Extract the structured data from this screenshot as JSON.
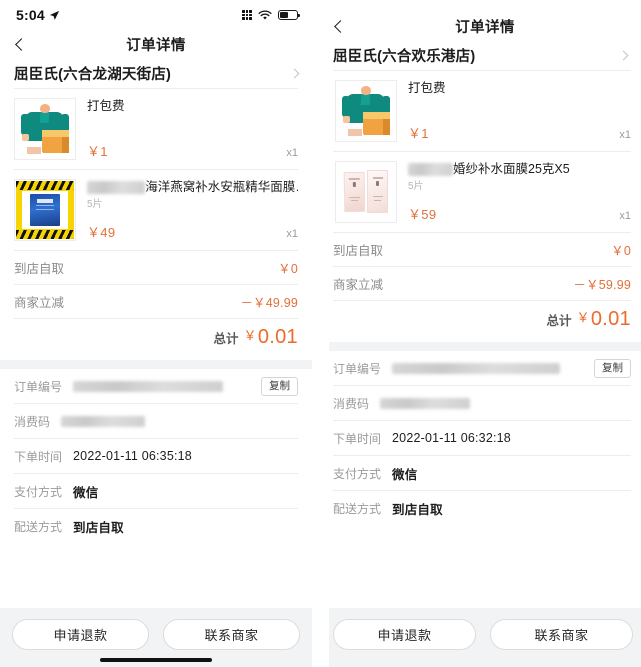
{
  "left": {
    "status_bar": {
      "time": "5:04",
      "location_icon": "location-arrow-icon",
      "signal_icon": "signal-dots-icon",
      "wifi_icon": "wifi-icon",
      "battery_icon": "battery-icon"
    },
    "nav": {
      "title": "订单详情",
      "back_icon": "chevron-left-icon"
    },
    "store": {
      "name": "屈臣氏(六合龙湖天街店)",
      "chevron_icon": "chevron-right-icon"
    },
    "items": [
      {
        "name": "打包费",
        "spec": "",
        "price": "￥1",
        "qty": "x1",
        "thumb": "packaging-fee-illustration",
        "redacted_prefix": false
      },
      {
        "name": "海洋燕窝补水安瓶精华面膜…",
        "spec": "5片",
        "price": "￥49",
        "qty": "x1",
        "thumb": "face-mask-box-caution-tape",
        "redacted_prefix": true
      }
    ],
    "fees": [
      {
        "label": "到店自取",
        "value": "￥0"
      },
      {
        "label": "商家立减",
        "value": "－￥49.99"
      }
    ],
    "total": {
      "label": "总计",
      "currency": "￥",
      "amount": "0.01"
    },
    "info": [
      {
        "label": "订单编号",
        "value": "",
        "redacted": true,
        "action": "复制"
      },
      {
        "label": "消费码",
        "value": "",
        "redacted": true,
        "action": ""
      },
      {
        "label": "下单时间",
        "value": "2022-01-11 06:35:18",
        "redacted": false,
        "action": ""
      },
      {
        "label": "支付方式",
        "value": "微信",
        "redacted": false,
        "action": ""
      },
      {
        "label": "配送方式",
        "value": "到店自取",
        "redacted": false,
        "action": ""
      }
    ],
    "actions": [
      "申请退款",
      "联系商家"
    ],
    "home_indicator": true
  },
  "right": {
    "nav": {
      "title": "订单详情",
      "back_icon": "chevron-left-icon"
    },
    "store": {
      "name": "屈臣氏(六合欢乐港店)",
      "chevron_icon": "chevron-right-icon"
    },
    "items": [
      {
        "name": "打包费",
        "spec": "",
        "price": "￥1",
        "qty": "x1",
        "thumb": "packaging-fee-illustration",
        "redacted_prefix": false
      },
      {
        "name": "婚纱补水面膜25克X5",
        "spec": "5片",
        "price": "￥59",
        "qty": "x1",
        "thumb": "wedding-mask-sachets",
        "redacted_prefix": true
      }
    ],
    "fees": [
      {
        "label": "到店自取",
        "value": "￥0"
      },
      {
        "label": "商家立减",
        "value": "－￥59.99"
      }
    ],
    "total": {
      "label": "总计",
      "currency": "￥",
      "amount": "0.01"
    },
    "info": [
      {
        "label": "订单编号",
        "value": "",
        "redacted": true,
        "action": "复制"
      },
      {
        "label": "消费码",
        "value": "",
        "redacted": true,
        "action": ""
      },
      {
        "label": "下单时间",
        "value": "2022-01-11 06:32:18",
        "redacted": false,
        "action": ""
      },
      {
        "label": "支付方式",
        "value": "微信",
        "redacted": false,
        "action": ""
      },
      {
        "label": "配送方式",
        "value": "到店自取",
        "redacted": false,
        "action": ""
      }
    ],
    "actions": [
      "申请退款",
      "联系商家"
    ],
    "home_indicator": false
  },
  "colors": {
    "accent_orange": "#e2703a",
    "total_orange": "#ec6a2c",
    "muted_grey": "#8c8c8c",
    "panel_grey": "#f2f3f5",
    "divider": "#ededed"
  }
}
